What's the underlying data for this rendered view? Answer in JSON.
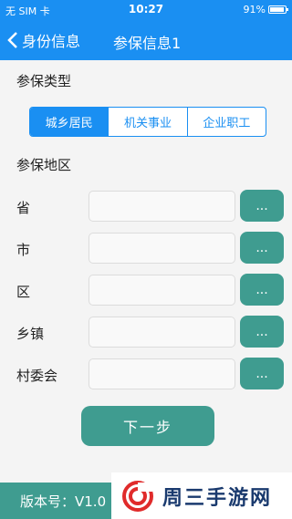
{
  "statusbar": {
    "carrier": "无 SIM 卡",
    "time": "10:27",
    "battery": "91%",
    "battery_level": 0.91
  },
  "navbar": {
    "back_label": "身份信息",
    "title": "参保信息1"
  },
  "insurance_type": {
    "title": "参保类型",
    "options": [
      "城乡居民",
      "机关事业",
      "企业职工"
    ],
    "selected": "城乡居民"
  },
  "region": {
    "title": "参保地区",
    "rows": [
      {
        "label": "省",
        "value": "",
        "button": "..."
      },
      {
        "label": "市",
        "value": "",
        "button": "..."
      },
      {
        "label": "区",
        "value": "",
        "button": "..."
      },
      {
        "label": "乡镇",
        "value": "",
        "button": "..."
      },
      {
        "label": "村委会",
        "value": "",
        "button": "..."
      }
    ]
  },
  "next_button": "下一步",
  "footer": {
    "version": "版本号：V1.0"
  },
  "watermark": {
    "text": "周三手游网"
  },
  "colors": {
    "primary": "#1a8ff2",
    "teal": "#3f9c90"
  }
}
